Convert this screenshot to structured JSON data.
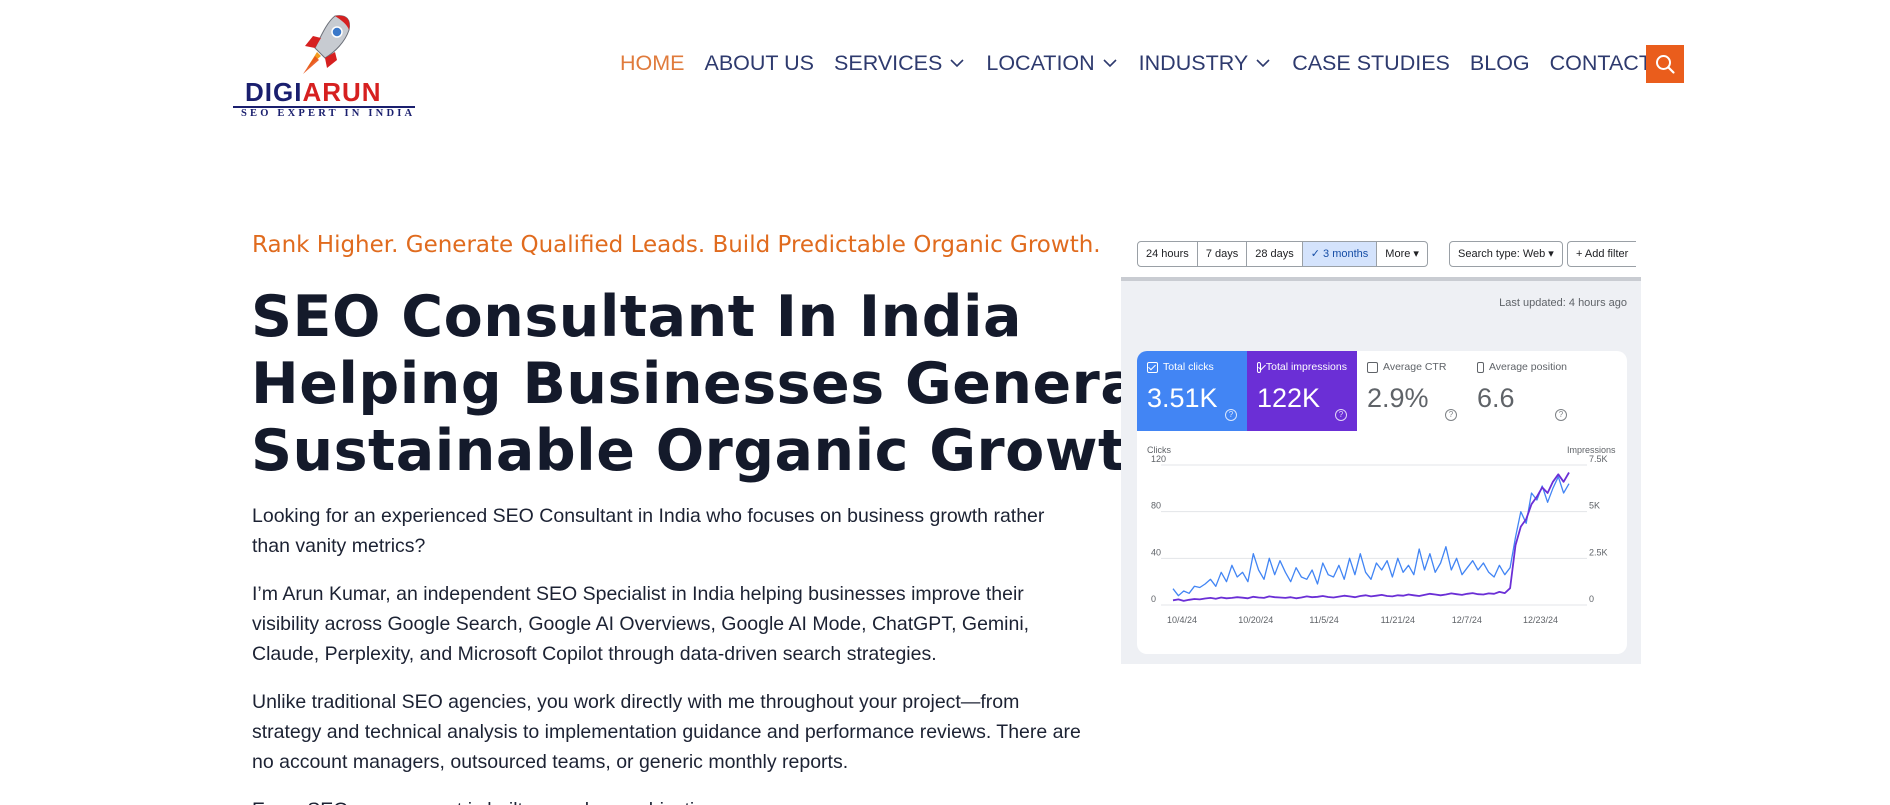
{
  "header": {
    "logo": {
      "word_part1": "DIGI",
      "word_part2": "ARUN",
      "tagline": "SEO EXPERT IN INDIA"
    },
    "nav": [
      {
        "label": "HOME",
        "active": true,
        "dropdown": false
      },
      {
        "label": "ABOUT US",
        "active": false,
        "dropdown": false
      },
      {
        "label": "SERVICES",
        "active": false,
        "dropdown": true
      },
      {
        "label": "LOCATION",
        "active": false,
        "dropdown": true
      },
      {
        "label": "INDUSTRY",
        "active": false,
        "dropdown": true
      },
      {
        "label": "CASE STUDIES",
        "active": false,
        "dropdown": false
      },
      {
        "label": "BLOG",
        "active": false,
        "dropdown": false
      },
      {
        "label": "CONTACT",
        "active": false,
        "dropdown": false
      }
    ],
    "search_icon": "search-icon"
  },
  "hero": {
    "tagline": "Rank Higher. Generate Qualified Leads. Build Predictable Organic Growth.",
    "headline_lines": [
      "SEO Consultant In India",
      "Helping Businesses Generate",
      "Sustainable Organic Growth"
    ],
    "paragraphs": [
      "Looking for an experienced SEO Consultant in India who focuses on business growth rather than vanity metrics?",
      "I’m Arun Kumar, an independent SEO Specialist in India helping businesses improve their visibility across Google Search, Google AI Overviews, Google AI Mode, ChatGPT, Gemini, Claude, Perplexity, and Microsoft Copilot through data-driven search strategies.",
      "Unlike traditional SEO agencies, you work directly with me throughout your project—from strategy and technical analysis to implementation guidance and performance reviews. There are no account managers, outsourced teams, or generic monthly reports.",
      "Every SEO engagement is built around your objectives."
    ]
  },
  "gsc": {
    "range_pills": [
      "24 hours",
      "7 days",
      "28 days",
      "3 months",
      "More"
    ],
    "selected_range": "3 months",
    "search_type": "Search type: Web",
    "add_filter": "Add filter",
    "last_updated": "Last updated: 4 hours ago",
    "metrics": [
      {
        "label": "Total clicks",
        "value": "3.51K",
        "checked": true
      },
      {
        "label": "Total impressions",
        "value": "122K",
        "checked": true
      },
      {
        "label": "Average CTR",
        "value": "2.9%",
        "checked": false
      },
      {
        "label": "Average position",
        "value": "6.6",
        "checked": false
      }
    ],
    "colors": {
      "clicks": "#4285f4",
      "impressions": "#6b2fd6",
      "accent": "#ea5d1c"
    }
  },
  "chart_data": {
    "type": "line",
    "x_tick_labels": [
      "10/4/24",
      "10/20/24",
      "11/5/24",
      "11/21/24",
      "12/7/24",
      "12/23/24"
    ],
    "left_axis": {
      "label": "Clicks",
      "ticks": [
        "120",
        "80",
        "40",
        "0"
      ],
      "ylim": [
        0,
        120
      ]
    },
    "right_axis": {
      "label": "Impressions",
      "ticks": [
        "7.5K",
        "5K",
        "2.5K",
        "0"
      ],
      "ylim": [
        0,
        7500
      ]
    },
    "grid": true,
    "series": [
      {
        "name": "Clicks",
        "color": "#4285f4",
        "axis": "left",
        "values": [
          14,
          8,
          12,
          10,
          16,
          15,
          18,
          22,
          16,
          28,
          20,
          34,
          24,
          28,
          20,
          44,
          30,
          22,
          40,
          26,
          38,
          28,
          20,
          32,
          24,
          22,
          30,
          18,
          36,
          26,
          24,
          34,
          22,
          40,
          26,
          44,
          28,
          22,
          36,
          30,
          38,
          24,
          40,
          28,
          34,
          26,
          48,
          30,
          44,
          28,
          36,
          50,
          30,
          40,
          26,
          32,
          38,
          30,
          36,
          28,
          24,
          34,
          26,
          32,
          58,
          80,
          70,
          96,
          90,
          102,
          88,
          100,
          110,
          96,
          104
        ]
      },
      {
        "name": "Impressions",
        "color": "#6b2fd6",
        "axis": "right",
        "values": [
          250,
          300,
          220,
          280,
          320,
          300,
          350,
          380,
          330,
          400,
          360,
          380,
          420,
          390,
          360,
          440,
          400,
          380,
          460,
          420,
          400,
          380,
          420,
          360,
          400,
          460,
          420,
          440,
          480,
          430,
          400,
          450,
          500,
          460,
          420,
          480,
          520,
          460,
          500,
          540,
          480,
          460,
          520,
          500,
          560,
          520,
          480,
          540,
          600,
          560,
          520,
          560,
          620,
          580,
          540,
          600,
          640,
          580,
          560,
          620,
          600,
          700,
          640,
          900,
          3200,
          4200,
          4600,
          5400,
          5800,
          6300,
          6000,
          6600,
          7000,
          6600,
          7100
        ]
      }
    ]
  }
}
